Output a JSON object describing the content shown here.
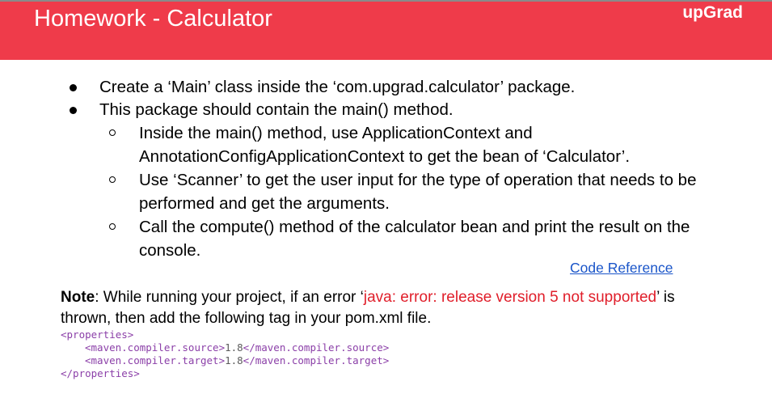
{
  "header": {
    "title": "Homework - Calculator",
    "logo": "upGrad",
    "accent_color": "#ef3b4a"
  },
  "bullets": [
    {
      "text": "Create a ‘Main’ class inside the ‘com.upgrad.calculator’ package."
    },
    {
      "text": "This package should contain the main() method.",
      "sub": [
        "Inside the main() method, use ApplicationContext and AnnotationConfigApplicationContext to get the bean of ‘Calculator’.",
        "Use ‘Scanner’ to get the user input for the type of operation that needs to be performed and get the arguments.",
        "Call the compute() method of the calculator bean and print the result on the console."
      ]
    }
  ],
  "code_reference": {
    "label": "Code Reference"
  },
  "note": {
    "label": "Note",
    "before": ": While running your project, if an error ‘",
    "error_text": "java: error: release version 5 not supported",
    "after": "’ is thrown, then add the following tag in your pom.xml file."
  },
  "code_block": {
    "line1": "<properties>",
    "line2_open": "<maven.compiler.source>",
    "line2_value": "1.8",
    "line2_close": "</maven.compiler.source>",
    "line3_open": "<maven.compiler.target>",
    "line3_value": "1.8",
    "line3_close": "</maven.compiler.target>",
    "line4": "</properties>"
  }
}
